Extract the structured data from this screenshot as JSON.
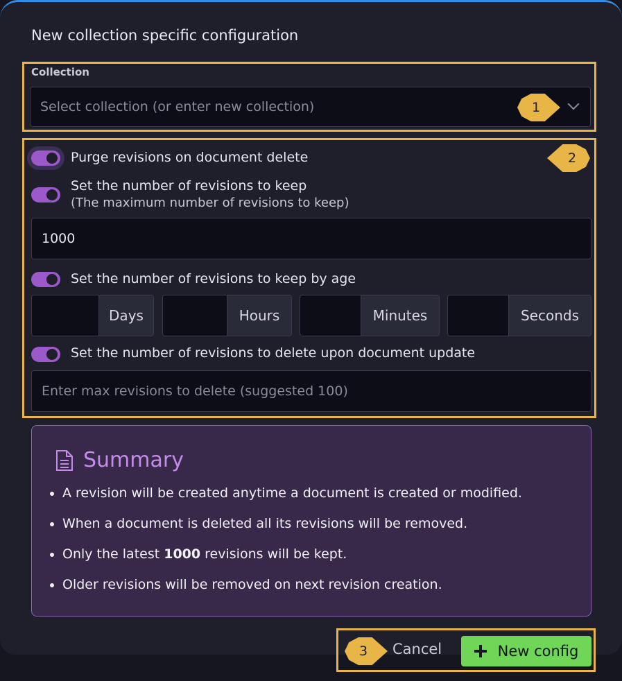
{
  "title": "New collection specific configuration",
  "collection": {
    "label": "Collection",
    "placeholder": "Select collection (or enter new collection)"
  },
  "callouts": [
    "1",
    "2",
    "3"
  ],
  "options": {
    "purge": {
      "label": "Purge revisions on document delete",
      "enabled": true
    },
    "keep_count": {
      "label": "Set the number of revisions to keep",
      "sublabel": "(The maximum number of revisions to keep)",
      "enabled": true,
      "value": "1000"
    },
    "keep_age": {
      "label": "Set the number of revisions to keep by age",
      "enabled": true,
      "units": [
        "Days",
        "Hours",
        "Minutes",
        "Seconds"
      ]
    },
    "delete_on_update": {
      "label": "Set the number of revisions to delete upon document update",
      "enabled": true,
      "placeholder": "Enter max revisions to delete (suggested 100)"
    }
  },
  "summary": {
    "title": "Summary",
    "items": [
      "A revision will be created anytime a document is created or modified.",
      "When a document is deleted all its revisions will be removed.",
      {
        "before": "Only the latest ",
        "bold": "1000",
        "after": " revisions will be kept."
      },
      "Older revisions will be removed on next revision creation."
    ]
  },
  "footer": {
    "cancel_label": "Cancel",
    "new_config_label": "New config"
  },
  "colors": {
    "accent": "#9b59c9",
    "primary_button": "#6fd658",
    "highlight": "#e8b547",
    "title_bar": "#2f8fe6"
  }
}
